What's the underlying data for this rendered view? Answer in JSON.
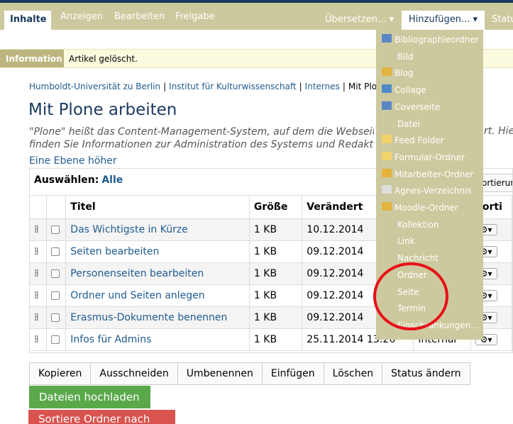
{
  "tabs": {
    "inhalte": "Inhalte",
    "anzeigen": "Anzeigen",
    "bearbeiten": "Bearbeiten",
    "freigabe": "Freigabe",
    "uebersetzen": "Übersetzen... ▾",
    "hinzufuegen": "Hinzufügen... ▾",
    "status": "Statu"
  },
  "info": {
    "label": "Information",
    "message": "Artikel gelöscht."
  },
  "breadcrumb": {
    "items": [
      "Humboldt-Universität zu Berlin",
      "Institut für Kulturwissenschaft",
      "Internes",
      "Mit Plone a"
    ],
    "separator": "|"
  },
  "page": {
    "title": "Mit Plone arbeiten",
    "desc_line1": "\"Plone\" heißt das Content-Management-System, auf dem die Webseit",
    "desc_line1_end": "rt. Hie",
    "desc_line2": "finden Sie Informationen zur Administration des Systems und Redakt",
    "up_link": "Eine Ebene höher"
  },
  "listing": {
    "select_label": "Auswählen:",
    "select_all": "Alle",
    "sort_button": "ortierung",
    "headers": {
      "title": "Titel",
      "size": "Größe",
      "modified": "Verändert",
      "actions": "Sorti"
    },
    "rows": [
      {
        "title": "Das Wichtigste in Kürze",
        "size": "1 KB",
        "modified": "10.12.2014",
        "state": ""
      },
      {
        "title": "Seiten bearbeiten",
        "size": "1 KB",
        "modified": "09.12.2014",
        "state": ""
      },
      {
        "title": "Personenseiten bearbeiten",
        "size": "1 KB",
        "modified": "09.12.2014",
        "state": ""
      },
      {
        "title": "Ordner und Seiten anlegen",
        "size": "1 KB",
        "modified": "09.12.2014",
        "state": ""
      },
      {
        "title": "Erasmus-Dokumente benennen",
        "size": "1 KB",
        "modified": "09.12.2014",
        "state": ""
      },
      {
        "title": "Infos für Admins",
        "size": "1 KB",
        "modified": "25.11.2014 13:26",
        "state": "Internal"
      }
    ],
    "gear_icon": "⚙▾"
  },
  "buttons": {
    "kopieren": "Kopieren",
    "ausschneiden": "Ausschneiden",
    "umbenennen": "Umbenennen",
    "einfuegen": "Einfügen",
    "loeschen": "Löschen",
    "status_aendern": "Status ändern",
    "upload": "Dateien hochladen",
    "sort_folder": "Sortiere Ordner nach"
  },
  "dropdown": {
    "items": [
      {
        "label": "Bibliographieordner",
        "icon": "bibliography-folder-icon",
        "icon_color": "#5a86c5"
      },
      {
        "label": "Bild",
        "icon": "",
        "icon_color": ""
      },
      {
        "label": "Blog",
        "icon": "blog-icon",
        "icon_color": "#e3b33c"
      },
      {
        "label": "Collage",
        "icon": "collage-icon",
        "icon_color": "#4e8bc8"
      },
      {
        "label": "Coverseite",
        "icon": "cover-page-icon",
        "icon_color": "#5a86c5"
      },
      {
        "label": "Datei",
        "icon": "",
        "icon_color": ""
      },
      {
        "label": "Feed Folder",
        "icon": "feed-folder-icon",
        "icon_color": "#f3d46b"
      },
      {
        "label": "Formular-Ordner",
        "icon": "form-folder-icon",
        "icon_color": "#f3d46b"
      },
      {
        "label": "Mitarbeiter-Ordner",
        "icon": "staff-folder-icon",
        "icon_color": "#e3b33c"
      },
      {
        "label": "Agnes-Verzeichnis",
        "icon": "agnes-directory-icon",
        "icon_color": "#dddddd"
      },
      {
        "label": "Moodle-Ordner",
        "icon": "moodle-folder-icon",
        "icon_color": "#e3b33c"
      },
      {
        "label": "Kollektion",
        "icon": "",
        "icon_color": ""
      },
      {
        "label": "Link",
        "icon": "",
        "icon_color": ""
      },
      {
        "label": "Nachricht",
        "icon": "",
        "icon_color": ""
      },
      {
        "label": "Ordner",
        "icon": "",
        "icon_color": ""
      },
      {
        "label": "Seite",
        "icon": "",
        "icon_color": ""
      },
      {
        "label": "Termin",
        "icon": "",
        "icon_color": ""
      },
      {
        "label": "Einschränkungen...",
        "icon": "",
        "icon_color": ""
      }
    ]
  },
  "colors": {
    "brand_dark": "#1a3a5e",
    "tab_olive": "#cdc99e",
    "link_blue": "#205c90",
    "upload_green": "#5aa84a",
    "danger_red": "#d9534f",
    "annotation_red": "#e8101a"
  }
}
